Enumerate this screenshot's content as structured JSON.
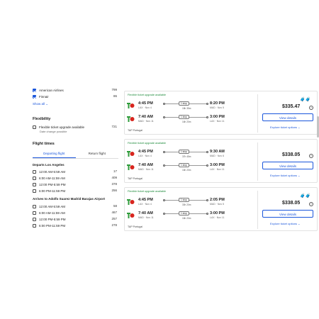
{
  "sidebar": {
    "airlines": [
      {
        "label": "American Airlines",
        "count": "799",
        "checked": true
      },
      {
        "label": "Finnair",
        "count": "86",
        "checked": true
      }
    ],
    "show_all": "Show all",
    "flexibility": {
      "title": "Flexibility",
      "option_label": "Flexible ticket upgrade available",
      "option_note": "Date change possible",
      "count": "721"
    },
    "flight_times": {
      "title": "Flight times",
      "tabs": [
        "Departing flight",
        "Return flight"
      ],
      "departs_title": "Departs Los Angeles",
      "departs": [
        {
          "label": "12:00 AM-5:59 AM",
          "count": "17"
        },
        {
          "label": "6:00 AM-11:59 AM",
          "count": "409"
        },
        {
          "label": "12:00 PM-5:59 PM",
          "count": "378"
        },
        {
          "label": "6:00 PM-11:59 PM",
          "count": "256"
        }
      ],
      "arrives_title": "Arrives to Adolfo Suarez Madrid Barajas Airport",
      "arrives": [
        {
          "label": "12:00 AM-5:59 AM",
          "count": "58"
        },
        {
          "label": "6:00 AM-11:59 AM",
          "count": "467"
        },
        {
          "label": "12:00 PM-5:59 PM",
          "count": "257"
        },
        {
          "label": "6:00 PM-11:59 PM",
          "count": "278"
        }
      ]
    }
  },
  "cards": [
    {
      "badge": "Flexible ticket upgrade available",
      "out": {
        "dep": "4:45 PM",
        "dep_sub": "LAX · Nov 4",
        "stops": "1 stop",
        "dur": "18h 35m",
        "arr": "8:20 PM",
        "arr_sub": "MAD · Nov 5"
      },
      "ret": {
        "dep": "7:40 AM",
        "dep_sub": "MAD · Nov 11",
        "stops": "1 stop",
        "dur": "16h 20m",
        "arr": "3:00 PM",
        "arr_sub": "LAX · Nov 11"
      },
      "airline": "TAP Portugal",
      "price": "$335.47",
      "view": "View details",
      "explore": "Explore ticket options"
    },
    {
      "badge": "Flexible ticket upgrade available",
      "out": {
        "dep": "4:45 PM",
        "dep_sub": "LAX · Nov 4",
        "stops": "1 stop",
        "dur": "37h 45m",
        "arr": "9:30 AM",
        "arr_sub": "MAD · Nov 6"
      },
      "ret": {
        "dep": "7:40 AM",
        "dep_sub": "MAD · Nov 11",
        "stops": "1 stop",
        "dur": "16h 20m",
        "arr": "3:00 PM",
        "arr_sub": "LAX · Nov 11"
      },
      "airline": "TAP Portugal",
      "price": "$338.05",
      "view": "View details",
      "explore": "Explore ticket options"
    },
    {
      "badge": "Flexible ticket upgrade available",
      "out": {
        "dep": "4:45 PM",
        "dep_sub": "LAX · Nov 4",
        "stops": "1 stop",
        "dur": "30h 20m",
        "arr": "2:05 PM",
        "arr_sub": "MAD · Nov 5"
      },
      "ret": {
        "dep": "7:40 AM",
        "dep_sub": "MAD · Nov 11",
        "stops": "1 stop",
        "dur": "16h 20m",
        "arr": "3:00 PM",
        "arr_sub": "LAX · Nov 11"
      },
      "airline": "TAP Portugal",
      "price": "$338.05",
      "view": "View details",
      "explore": "Explore ticket options"
    }
  ],
  "colors": {
    "accent": "#1a56db",
    "badge": "#1c8a3a",
    "tap_red": "#d7261e",
    "tap_green": "#2e9b3a"
  }
}
